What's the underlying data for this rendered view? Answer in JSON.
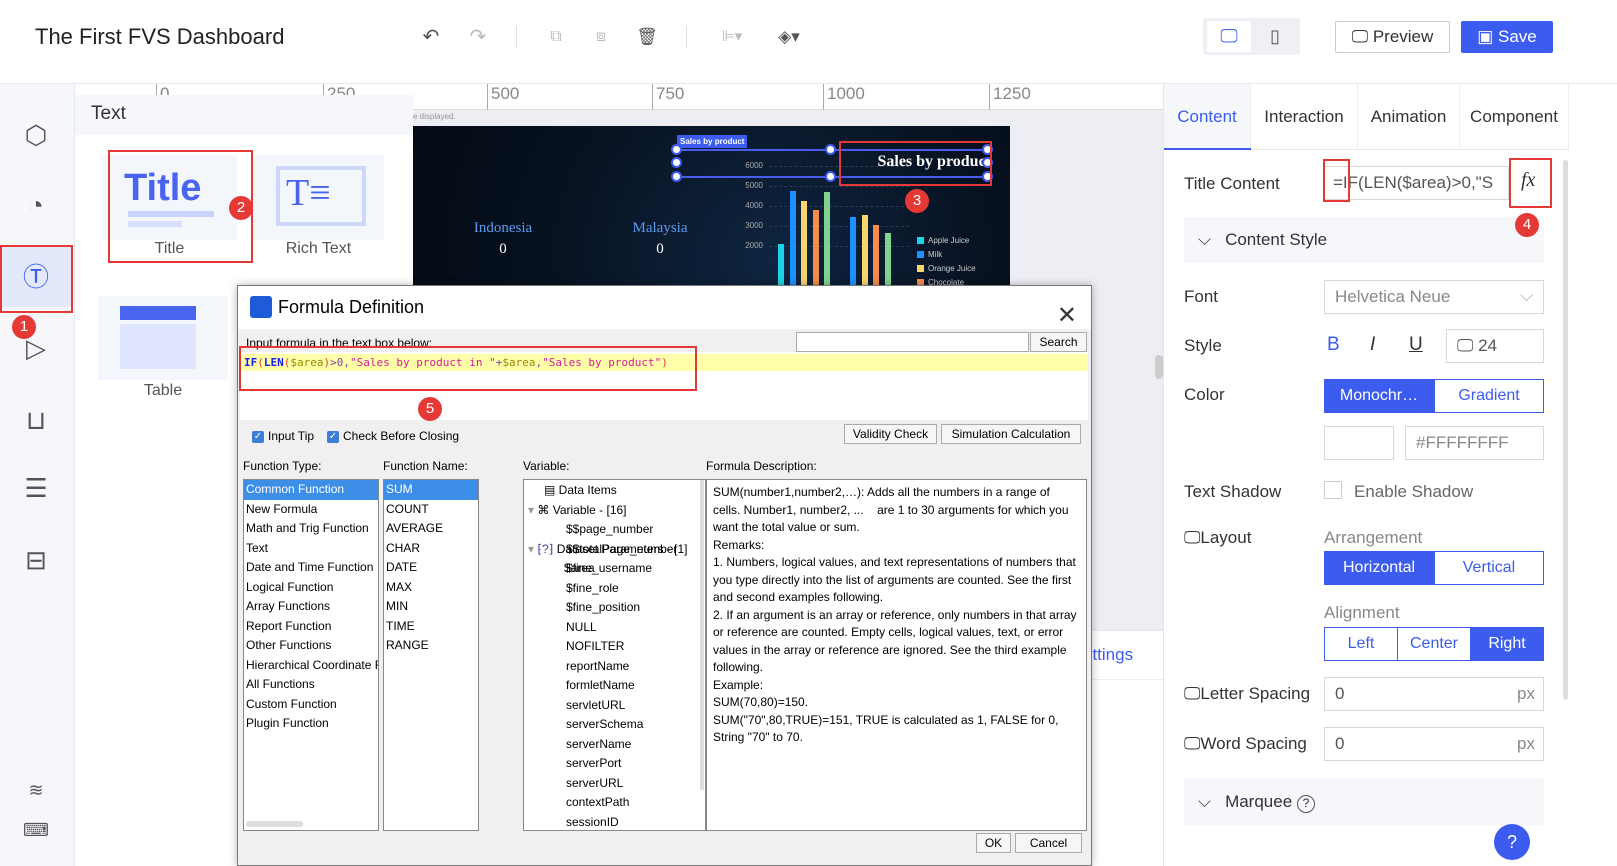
{
  "header": {
    "title": "The First FVS Dashboard",
    "preview_label": "Preview",
    "save_label": "Save"
  },
  "text_panel": {
    "heading": "Text",
    "items": [
      {
        "label": "Title",
        "art": "Title"
      },
      {
        "label": "Rich Text"
      },
      {
        "label": "Table"
      }
    ]
  },
  "ruler": {
    "ticks": [
      "0",
      "250",
      "500",
      "750",
      "1000",
      "1250"
    ],
    "note": "e displayed."
  },
  "canvas": {
    "selection_tag": "Sales by product",
    "title_text": "Sales by product",
    "countries": [
      {
        "name": "Indonesia",
        "value": "0"
      },
      {
        "name": "Malaysia",
        "value": "0"
      }
    ],
    "behind_dialog_link": "ettings"
  },
  "chart_data": {
    "type": "bar",
    "yticks": [
      "6000",
      "5000",
      "4000",
      "3000",
      "2000"
    ],
    "ylim": [
      0,
      6000
    ],
    "series": [
      {
        "name": "Apple Juice",
        "color": "#19d4e6",
        "values": [
          2100,
          0
        ]
      },
      {
        "name": "Milk",
        "color": "#1e90ff",
        "values": [
          4750,
          3450
        ]
      },
      {
        "name": "Orange Juice",
        "color": "#f9d56e",
        "values": [
          4250,
          3550
        ]
      },
      {
        "name": "Chocolate",
        "color": "#f58b4c",
        "values": [
          3800,
          3050
        ]
      },
      {
        "name": "",
        "color": "#7ed48f",
        "values": [
          4700,
          2650
        ]
      }
    ],
    "legend": [
      "Apple Juice",
      "Milk",
      "Orange Juice",
      "Chocolate"
    ]
  },
  "right_panel": {
    "tabs": [
      "Content",
      "Interaction",
      "Animation",
      "Component"
    ],
    "title_content_label": "Title Content",
    "title_content_value": "=IF(LEN($area)>0,\"S",
    "fx_label": "fx",
    "content_style_label": "Content Style",
    "font_label": "Font",
    "font_value": "Helvetica Neue",
    "style_label": "Style",
    "bold": "B",
    "italic": "I",
    "underline": "U",
    "font_size": "24",
    "color_label": "Color",
    "color_modes": [
      "Monochr…",
      "Gradient"
    ],
    "color_value": "#FFFFFFFF",
    "shadow_label": "Text Shadow",
    "shadow_option": "Enable Shadow",
    "layout_label": "Layout",
    "arrangement_label": "Arrangement",
    "arrangement": [
      "Horizontal",
      "Vertical"
    ],
    "alignment_label": "Alignment",
    "alignment": [
      "Left",
      "Center",
      "Right"
    ],
    "letter_spacing_label": "Letter Spacing",
    "letter_spacing": "0",
    "word_spacing_label": "Word Spacing",
    "word_spacing": "0",
    "unit": "px",
    "marquee_label": "Marquee",
    "help": "?"
  },
  "dialog": {
    "title": "Formula Definition",
    "input_label": "Input formula in the text box below:",
    "search_label": "Search",
    "formula": {
      "p1": "IF",
      "p2": "(",
      "p3": "LEN",
      "p4": "(",
      "p5": "$area",
      "p6": ")",
      "p7": ">0,",
      "p8": "\"Sales by product in \"",
      "p9": "+",
      "p10": "$area",
      "p11": ",",
      "p12": "\"Sales by product\"",
      "p13": ")"
    },
    "input_tip": "Input Tip",
    "check_before_closing": "Check Before Closing",
    "validity_check": "Validity Check",
    "simulation": "Simulation Calculation",
    "function_type_label": "Function Type:",
    "function_name_label": "Function Name:",
    "variable_label": "Variable:",
    "description_label": "Formula Description:",
    "function_types": [
      "Common Function",
      "New Formula",
      "Math and Trig Function",
      "Text",
      "Date and Time Function",
      "Logical Function",
      "Array Functions",
      "Report Function",
      "Other Functions",
      "Hierarchical Coordinate F",
      "All Functions",
      "Custom Function",
      "Plugin Function"
    ],
    "function_names": [
      "SUM",
      "COUNT",
      "AVERAGE",
      "CHAR",
      "DATE",
      "MAX",
      "MIN",
      "TIME",
      "RANGE"
    ],
    "variables": {
      "data_items": "Data Items",
      "variable_group": "Variable - [16]",
      "items": [
        "$$page_number",
        "$$totalPage_number",
        "$fine_username",
        "$fine_role",
        "$fine_position",
        "NULL",
        "NOFILTER",
        "reportName",
        "formletName",
        "servletURL",
        "serverSchema",
        "serverName",
        "serverPort",
        "serverURL",
        "contextPath",
        "sessionID"
      ],
      "dataset_group": "Dataset Parameters - [1]",
      "dataset_items": [
        "$area"
      ]
    },
    "description": "SUM(number1,number2,…): Adds all the numbers in a range of cells. Number1, number2, ...    are 1 to 30 arguments for which you want the total value or sum.\nRemarks:\n1. Numbers, logical values, and text representations of numbers that you type directly into the list of arguments are counted. See the first and second examples following.\n2. If an argument is an array or reference, only numbers in that array or reference are counted. Empty cells, logical values, text, or error values in the array or reference are ignored. See the third example following.\nExample:\nSUM(70,80)=150.\nSUM(\"70\",80,TRUE)=151, TRUE is calculated as 1, FALSE for 0, String \"70\" to 70.",
    "ok_label": "OK",
    "cancel_label": "Cancel"
  },
  "annotations": [
    "1",
    "2",
    "3",
    "4",
    "5"
  ]
}
